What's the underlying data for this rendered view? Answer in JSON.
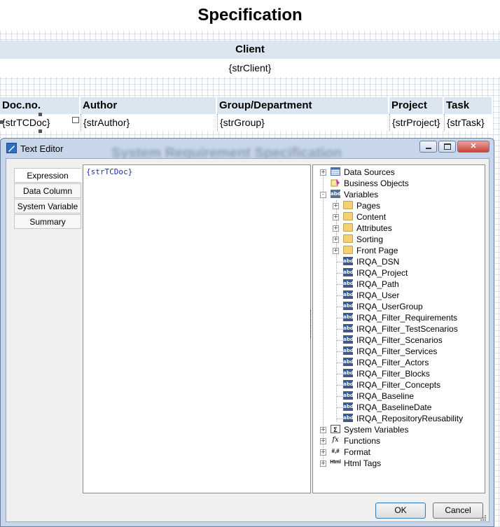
{
  "report": {
    "title": "Specification",
    "client_header": "Client",
    "client_value": "{strClient}",
    "columns": [
      {
        "header": "Doc.no.",
        "value": "{strTCDoc}"
      },
      {
        "header": "Author",
        "value": "{strAuthor}"
      },
      {
        "header": "Group/Department",
        "value": "{strGroup}"
      },
      {
        "header": "Project",
        "value": "{strProject}"
      },
      {
        "header": "Task",
        "value": "{strTask}"
      }
    ]
  },
  "dialog": {
    "title": "Text Editor",
    "background_title": "System Requirement Specification",
    "tabs": [
      "Expression",
      "Data Column",
      "System Variable",
      "Summary"
    ],
    "active_tab": "Expression",
    "expression_text": "{strTCDoc}",
    "ok_label": "OK",
    "cancel_label": "Cancel"
  },
  "tree": {
    "root": [
      {
        "label": "Data Sources",
        "icon": "data-sources-icon",
        "expander": "+"
      },
      {
        "label": "Business Objects",
        "icon": "business-objects-icon",
        "expander": ""
      },
      {
        "label": "Variables",
        "icon": "variables-icon",
        "expander": "-"
      }
    ],
    "variable_folders": [
      "Pages",
      "Content",
      "Attributes",
      "Sorting",
      "Front Page"
    ],
    "variables": [
      "IRQA_DSN",
      "IRQA_Project",
      "IRQA_Path",
      "IRQA_User",
      "IRQA_UserGroup",
      "IRQA_Filter_Requirements",
      "IRQA_Filter_TestScenarios",
      "IRQA_Filter_Scenarios",
      "IRQA_Filter_Services",
      "IRQA_Filter_Actors",
      "IRQA_Filter_Blocks",
      "IRQA_Filter_Concepts",
      "IRQA_Baseline",
      "IRQA_BaselineDate",
      "IRQA_RepositoryReusability"
    ],
    "variable_icon_text": "abd",
    "bottom": [
      {
        "label": "System Variables",
        "icon": "system-variables-icon",
        "glyph": "Σ"
      },
      {
        "label": "Functions",
        "icon": "function-icon",
        "glyph": "fx"
      },
      {
        "label": "Format",
        "icon": "format-icon",
        "glyph": "#,#"
      },
      {
        "label": "Html Tags",
        "icon": "html-tags-icon",
        "glyph": "Html"
      }
    ]
  },
  "colors": {
    "header_band": "#dce6f1",
    "dialog_frame": "#c7d6ea",
    "expression_text": "#1f2fa8"
  }
}
